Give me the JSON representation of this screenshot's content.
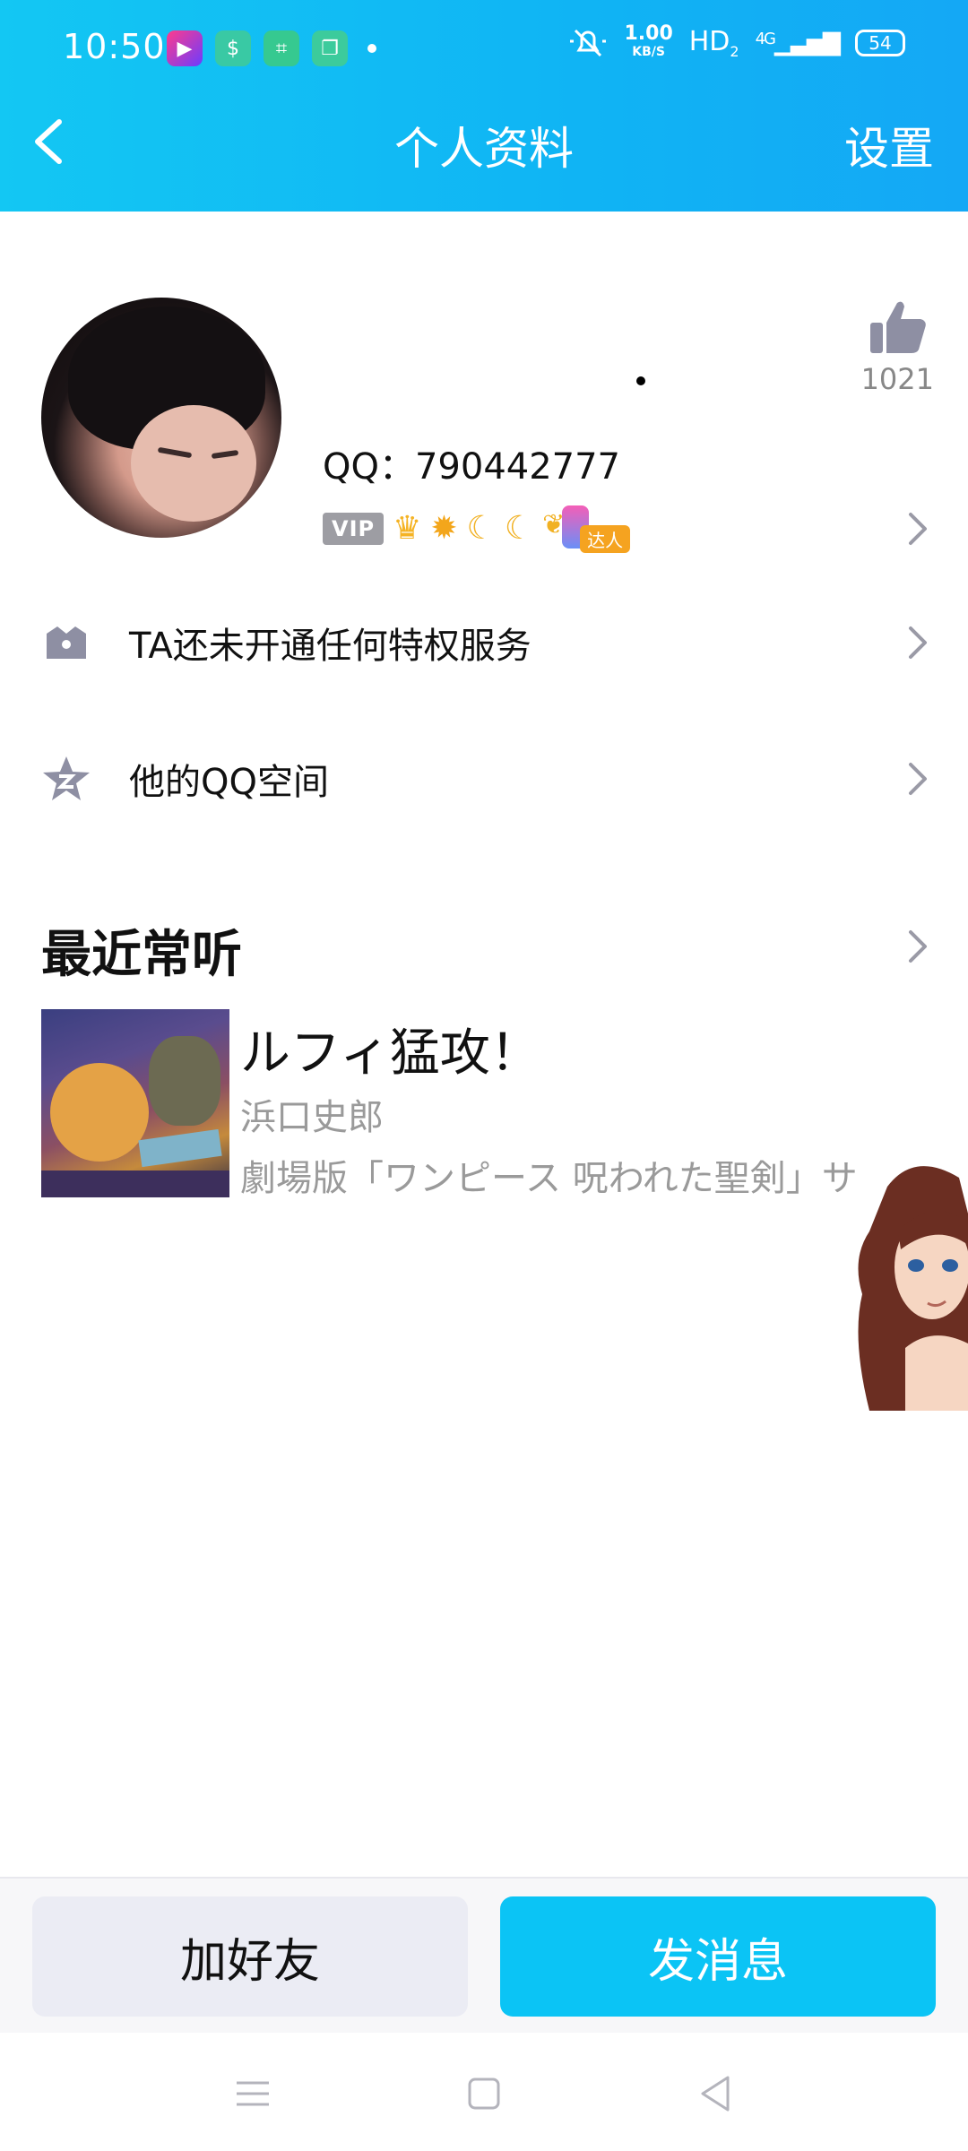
{
  "status_bar": {
    "time": "10:50",
    "net_speed_value": "1.00",
    "net_speed_unit": "KB/S",
    "hd": "HD",
    "hd_sub": "2",
    "signal": "4G",
    "battery": "54"
  },
  "nav": {
    "title": "个人资料",
    "settings": "设置"
  },
  "profile": {
    "qq_label": "QQ：790442777",
    "vip_badge": "VIP",
    "daren_tag": "达人",
    "like_count": "1021"
  },
  "rows": {
    "privilege": "TA还未开通任何特权服务",
    "qzone": "他的QQ空间"
  },
  "recent": {
    "title": "最近常听",
    "song_title": "ルフィ猛攻！",
    "artist": "浜口史郎",
    "album": "劇場版「ワンピース 呪われた聖剣」サ"
  },
  "actions": {
    "add_friend": "加好友",
    "send_message": "发消息"
  },
  "colors": {
    "header_gradient_start": "#13c7f3",
    "header_gradient_end": "#14a8f5",
    "primary_button": "#0bc4f5",
    "secondary_button": "#ebecf4",
    "icon_gray": "#8e8fa3"
  }
}
